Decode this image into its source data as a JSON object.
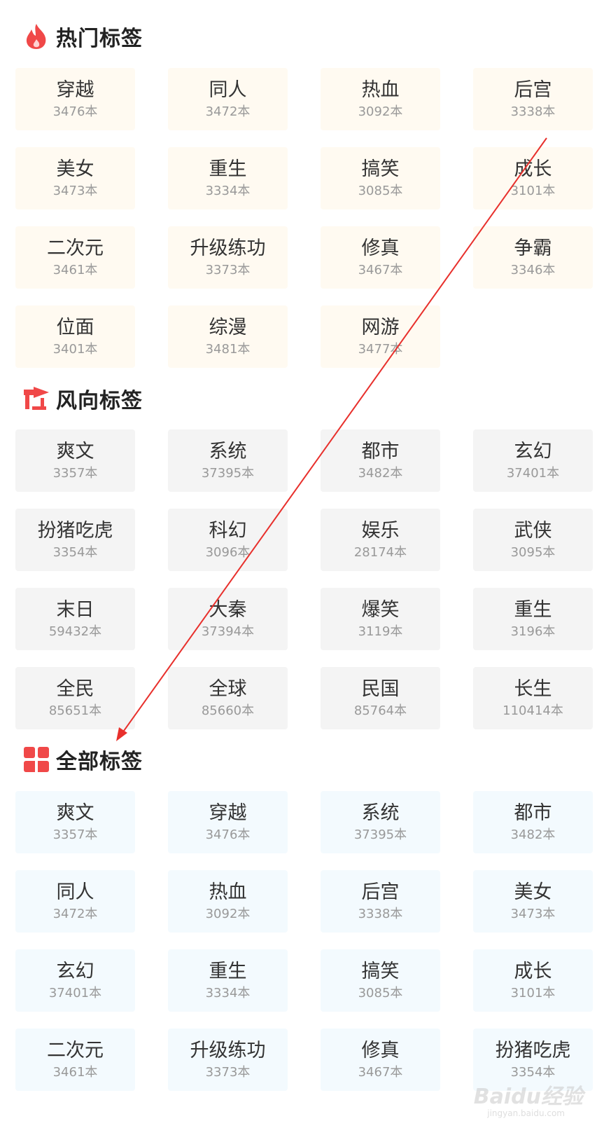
{
  "sections": {
    "hot": {
      "title": "热门标签",
      "icon": "flame-icon",
      "tags": [
        {
          "name": "穿越",
          "count": "3476本"
        },
        {
          "name": "同人",
          "count": "3472本"
        },
        {
          "name": "热血",
          "count": "3092本"
        },
        {
          "name": "后宫",
          "count": "3338本"
        },
        {
          "name": "美女",
          "count": "3473本"
        },
        {
          "name": "重生",
          "count": "3334本"
        },
        {
          "name": "搞笑",
          "count": "3085本"
        },
        {
          "name": "成长",
          "count": "3101本"
        },
        {
          "name": "二次元",
          "count": "3461本"
        },
        {
          "name": "升级练功",
          "count": "3373本"
        },
        {
          "name": "修真",
          "count": "3467本"
        },
        {
          "name": "争霸",
          "count": "3346本"
        },
        {
          "name": "位面",
          "count": "3401本"
        },
        {
          "name": "综漫",
          "count": "3481本"
        },
        {
          "name": "网游",
          "count": "3477本"
        }
      ]
    },
    "trend": {
      "title": "风向标签",
      "icon": "weathervane-icon",
      "tags": [
        {
          "name": "爽文",
          "count": "3357本"
        },
        {
          "name": "系统",
          "count": "37395本"
        },
        {
          "name": "都市",
          "count": "3482本"
        },
        {
          "name": "玄幻",
          "count": "37401本"
        },
        {
          "name": "扮猪吃虎",
          "count": "3354本"
        },
        {
          "name": "科幻",
          "count": "3096本"
        },
        {
          "name": "娱乐",
          "count": "28174本"
        },
        {
          "name": "武侠",
          "count": "3095本"
        },
        {
          "name": "末日",
          "count": "59432本"
        },
        {
          "name": "大秦",
          "count": "37394本"
        },
        {
          "name": "爆笑",
          "count": "3119本"
        },
        {
          "name": "重生",
          "count": "3196本"
        },
        {
          "name": "全民",
          "count": "85651本"
        },
        {
          "name": "全球",
          "count": "85660本"
        },
        {
          "name": "民国",
          "count": "85764本"
        },
        {
          "name": "长生",
          "count": "110414本"
        }
      ]
    },
    "all": {
      "title": "全部标签",
      "icon": "grid-blocks-icon",
      "tags": [
        {
          "name": "爽文",
          "count": "3357本"
        },
        {
          "name": "穿越",
          "count": "3476本"
        },
        {
          "name": "系统",
          "count": "37395本"
        },
        {
          "name": "都市",
          "count": "3482本"
        },
        {
          "name": "同人",
          "count": "3472本"
        },
        {
          "name": "热血",
          "count": "3092本"
        },
        {
          "name": "后宫",
          "count": "3338本"
        },
        {
          "name": "美女",
          "count": "3473本"
        },
        {
          "name": "玄幻",
          "count": "37401本"
        },
        {
          "name": "重生",
          "count": "3334本"
        },
        {
          "name": "搞笑",
          "count": "3085本"
        },
        {
          "name": "成长",
          "count": "3101本"
        },
        {
          "name": "二次元",
          "count": "3461本"
        },
        {
          "name": "升级练功",
          "count": "3373本"
        },
        {
          "name": "修真",
          "count": "3467本"
        },
        {
          "name": "扮猪吃虎",
          "count": "3354本"
        }
      ]
    }
  },
  "colors": {
    "accent": "#f04848",
    "arrow": "#e8302c"
  },
  "watermark": {
    "brand": "Baidu经验",
    "url": "jingyan.baidu.com"
  }
}
